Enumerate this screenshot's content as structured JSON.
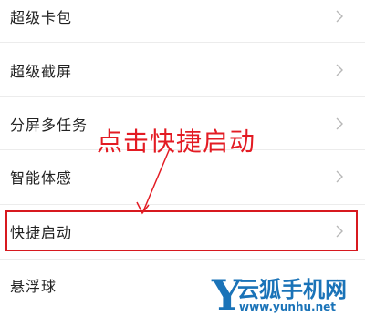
{
  "settings": {
    "items": [
      {
        "label": "超级卡包",
        "icon": "chevron-right-icon"
      },
      {
        "label": "超级截屏",
        "icon": "chevron-right-icon"
      },
      {
        "label": "分屏多任务",
        "icon": "chevron-right-icon"
      },
      {
        "label": "智能体感",
        "icon": "chevron-right-icon"
      },
      {
        "label": "快捷启动",
        "icon": "chevron-right-icon"
      },
      {
        "label": "悬浮球",
        "icon": "chevron-right-icon"
      }
    ]
  },
  "annotation": {
    "text": "点击快捷启动",
    "color": "#e31b23"
  },
  "watermark": {
    "logo_letter": "Y",
    "name": "云狐手机网",
    "url": "www.yunhu.net",
    "color": "#1a73b8"
  }
}
